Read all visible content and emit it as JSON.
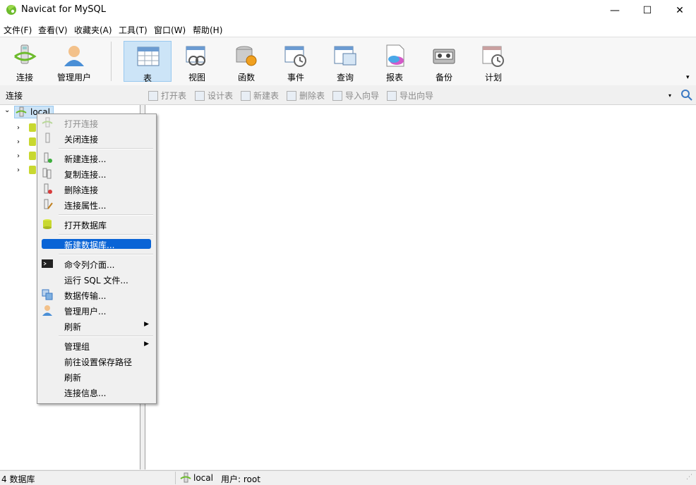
{
  "window": {
    "title": "Navicat for MySQL",
    "minimize": "—",
    "maximize": "☐",
    "close": "✕"
  },
  "menu": [
    "文件(F)",
    "查看(V)",
    "收藏夹(A)",
    "工具(T)",
    "窗口(W)",
    "帮助(H)"
  ],
  "toolbar": {
    "buttons": [
      "连接",
      "管理用户",
      "表",
      "视图",
      "函数",
      "事件",
      "查询",
      "报表",
      "备份",
      "计划"
    ],
    "active": "表",
    "overflow": "▾"
  },
  "subbar": {
    "header": "连接",
    "buttons": [
      "打开表",
      "设计表",
      "新建表",
      "删除表",
      "导入向导",
      "导出向导"
    ]
  },
  "tree": {
    "root": "local",
    "child_count": 4
  },
  "context_menu": {
    "items": [
      "打开连接",
      "关闭连接",
      "新建连接...",
      "复制连接...",
      "删除连接",
      "连接属性...",
      "打开数据库",
      "新建数据库...",
      "命令列介面...",
      "运行 SQL 文件...",
      "数据传输...",
      "管理用户...",
      "刷新",
      "管理组",
      "前往设置保存路径",
      "刷新",
      "连接信息..."
    ],
    "highlighted": "新建数据库...",
    "disabled": "打开连接"
  },
  "status": {
    "db_count": "4 数据库",
    "connection": "local",
    "user": "用户: root"
  },
  "colors": {
    "highlight": "#0a64d6",
    "active_button": "#cce4f7"
  }
}
